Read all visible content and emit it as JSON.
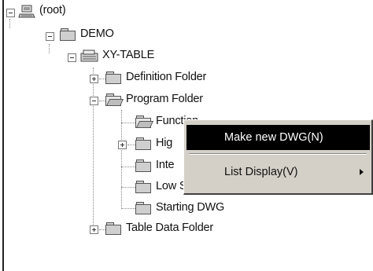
{
  "tree": {
    "root": "(root)",
    "demo": "DEMO",
    "xy_table": "XY-TABLE",
    "definition_folder": "Definition Folder",
    "program_folder": "Program Folder",
    "function": "Function",
    "high": "Hig",
    "interrupt": "Inte",
    "low_scan": "Low Scan",
    "starting_dwg": "Starting DWG",
    "table_data_folder": "Table Data Folder"
  },
  "context_menu": {
    "make_new_dwg": "Make new DWG(N)",
    "list_display": "List Display(V)"
  },
  "colors": {
    "menu_background": "#d4d0c8",
    "menu_highlight": "#000000"
  }
}
